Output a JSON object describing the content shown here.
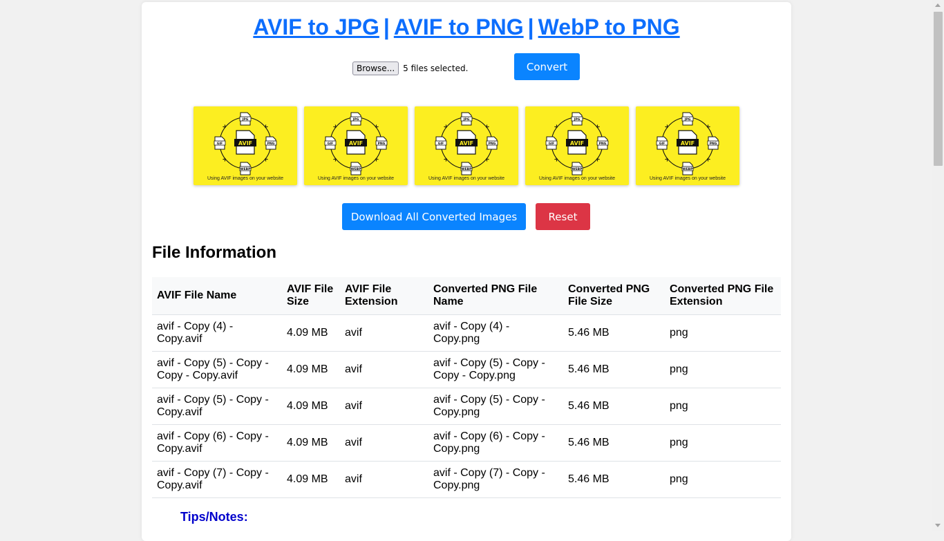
{
  "header": {
    "links": [
      {
        "label": "AVIF to JPG"
      },
      {
        "label": "AVIF to PNG"
      },
      {
        "label": "WebP to PNG"
      }
    ],
    "separator": "|"
  },
  "upload": {
    "browse_label": "Browse...",
    "status": "5 files selected.",
    "convert_label": "Convert"
  },
  "thumbnails": {
    "count": 5,
    "background_color": "#fcee21",
    "center_label": "AVIF",
    "format_labels": [
      "JPG",
      "PNG",
      "WEBP",
      "GIF"
    ],
    "caption": "Using AVIF images on your website"
  },
  "actions": {
    "download_label": "Download All Converted Images",
    "reset_label": "Reset"
  },
  "file_info": {
    "title": "File Information",
    "columns": [
      "AVIF File Name",
      "AVIF File Size",
      "AVIF File Extension",
      "Converted PNG File Name",
      "Converted PNG File Size",
      "Converted PNG File Extension"
    ],
    "rows": [
      [
        "avif - Copy (4) - Copy.avif",
        "4.09 MB",
        "avif",
        "avif - Copy (4) - Copy.png",
        "5.46 MB",
        "png"
      ],
      [
        "avif - Copy (5) - Copy - Copy - Copy.avif",
        "4.09 MB",
        "avif",
        "avif - Copy (5) - Copy - Copy - Copy.png",
        "5.46 MB",
        "png"
      ],
      [
        "avif - Copy (5) - Copy - Copy.avif",
        "4.09 MB",
        "avif",
        "avif - Copy (5) - Copy - Copy.png",
        "5.46 MB",
        "png"
      ],
      [
        "avif - Copy (6) - Copy - Copy.avif",
        "4.09 MB",
        "avif",
        "avif - Copy (6) - Copy - Copy.png",
        "5.46 MB",
        "png"
      ],
      [
        "avif - Copy (7) - Copy - Copy.avif",
        "4.09 MB",
        "avif",
        "avif - Copy (7) - Copy - Copy.png",
        "5.46 MB",
        "png"
      ]
    ]
  },
  "tips": {
    "title": "Tips/Notes:"
  },
  "colors": {
    "link": "#0d6efd",
    "primary_button": "#0a84ff",
    "danger_button": "#dc3545",
    "tips_title": "#0000cc"
  }
}
